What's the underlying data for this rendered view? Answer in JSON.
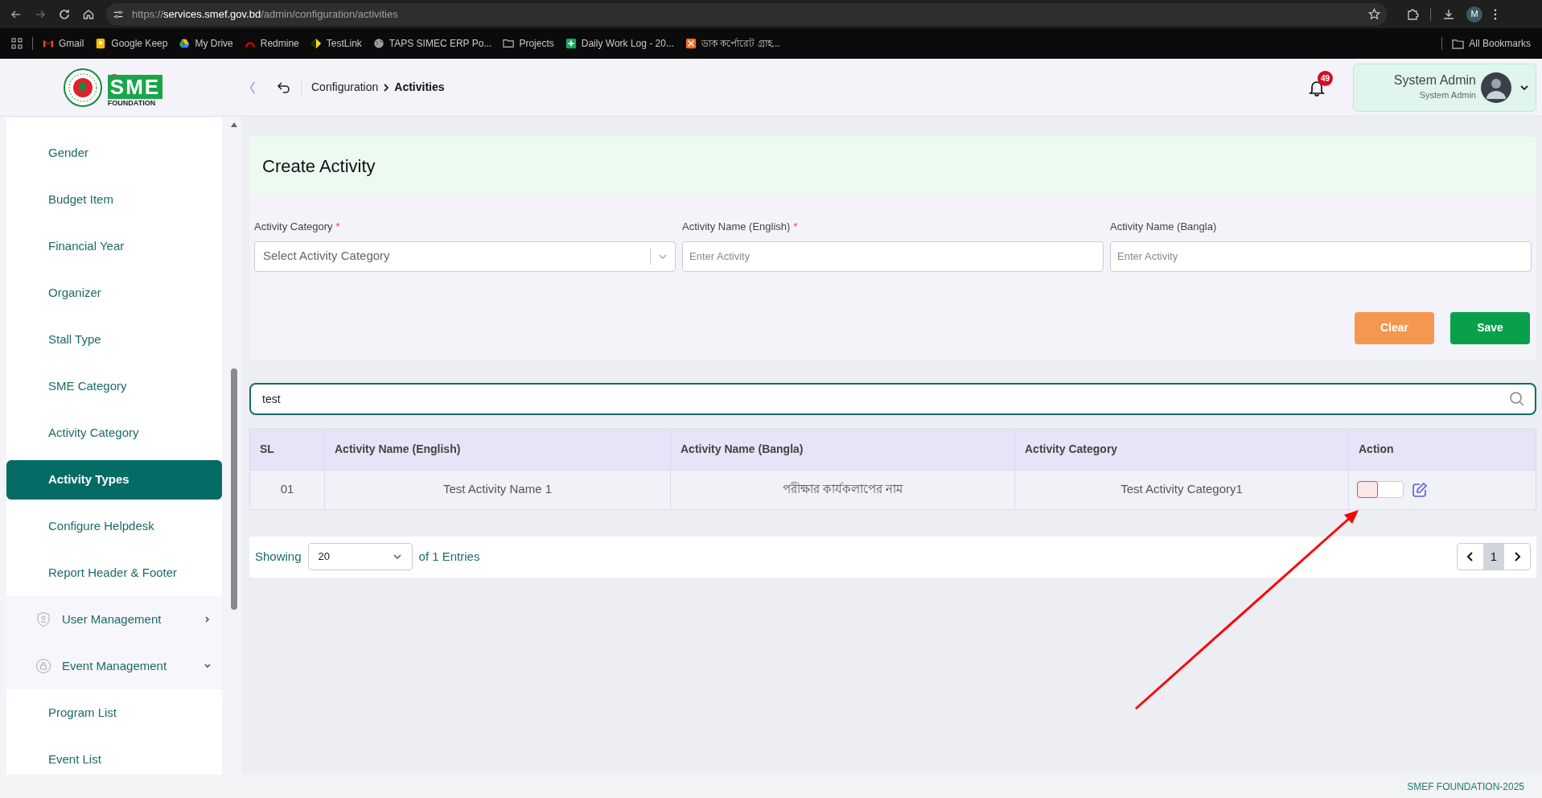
{
  "browser": {
    "url": "https://**services.smef.gov.bd**/admin/configuration/activities",
    "profile": "M",
    "all_bookmarks": "All Bookmarks",
    "bookmarks": [
      {
        "label": "Gmail"
      },
      {
        "label": "Google Keep"
      },
      {
        "label": "My Drive"
      },
      {
        "label": "Redmine"
      },
      {
        "label": "TestLink"
      },
      {
        "label": "TAPS SIMEC ERP Po..."
      },
      {
        "label": "Projects"
      },
      {
        "label": "Daily Work Log - 20..."
      },
      {
        "label": "ডাক কর্পোরেট গ্রাহ..."
      }
    ]
  },
  "header": {
    "logo_text": "SME",
    "logo_subtitle": "FOUNDATION",
    "breadcrumb": [
      "Configuration",
      "Activities"
    ],
    "notifications": "49",
    "user_name": "System Admin",
    "user_role": "System Admin"
  },
  "sidebar": {
    "items": [
      {
        "kind": "link",
        "label": "Gender",
        "selected": false
      },
      {
        "kind": "link",
        "label": "Budget Item",
        "selected": false
      },
      {
        "kind": "link",
        "label": "Financial Year",
        "selected": false
      },
      {
        "kind": "link",
        "label": "Organizer",
        "selected": false
      },
      {
        "kind": "link",
        "label": "Stall Type",
        "selected": false
      },
      {
        "kind": "link",
        "label": "SME Category",
        "selected": false
      },
      {
        "kind": "link",
        "label": "Activity Category",
        "selected": false
      },
      {
        "kind": "link",
        "label": "Activity Types",
        "selected": true
      },
      {
        "kind": "link",
        "label": "Configure Helpdesk",
        "selected": false
      },
      {
        "kind": "link",
        "label": "Report Header & Footer",
        "selected": false
      },
      {
        "kind": "group",
        "label": "User Management",
        "expanded": false
      },
      {
        "kind": "group",
        "label": "Event Management",
        "expanded": true
      },
      {
        "kind": "link",
        "label": "Program List",
        "selected": false
      },
      {
        "kind": "link",
        "label": "Event List",
        "selected": false
      }
    ]
  },
  "form": {
    "title": "Create Activity",
    "required_mark": "*",
    "fields": [
      {
        "kind": "select",
        "label": "Activity Category",
        "required": true,
        "placeholder": "Select Activity Category"
      },
      {
        "kind": "text",
        "label": "Activity Name (English)",
        "required": true,
        "placeholder": "Enter Activity"
      },
      {
        "kind": "text",
        "label": "Activity Name (Bangla)",
        "required": false,
        "placeholder": "Enter Activity"
      }
    ],
    "buttons": [
      {
        "kind": "clear",
        "label": "Clear"
      },
      {
        "kind": "save",
        "label": "Save"
      }
    ]
  },
  "search": {
    "value": "test"
  },
  "table": {
    "columns": [
      "SL",
      "Activity Name (English)",
      "Activity Name (Bangla)",
      "Activity Category",
      "Action"
    ],
    "rows": [
      {
        "cells": [
          "01",
          "Test Activity Name 1",
          "পরীক্ষার কার্যকলাপের নাম",
          "Test Activity Category1"
        ],
        "on": false
      }
    ]
  },
  "pagination": {
    "showing": "Showing",
    "page_size": "20",
    "entries": "of 1 Entries",
    "pages": [
      {
        "label": "1",
        "selected": true
      }
    ]
  },
  "footer": "SMEF FOUNDATION-2025"
}
